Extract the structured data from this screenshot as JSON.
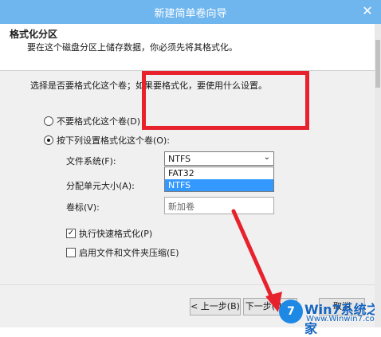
{
  "window": {
    "title": "新建简单卷向导",
    "close_glyph": "✕"
  },
  "header": {
    "title": "格式化分区",
    "subtitle": "要在这个磁盘分区上储存数据，你必须先将其格式化。"
  },
  "prompt": "选择是否要格式化这个卷；如果要格式化，要使用什么设置。",
  "options": {
    "no_format": "不要格式化这个卷(D)",
    "format": "按下列设置格式化这个卷(O):"
  },
  "fields": {
    "filesystem_label": "文件系统(F):",
    "filesystem_value": "NTFS",
    "filesystem_options": [
      "FAT32",
      "NTFS"
    ],
    "allocation_label": "分配单元大小(A):",
    "volume_label_label": "卷标(V):",
    "volume_label_value": "新加卷"
  },
  "checkboxes": {
    "quick_format": "执行快速格式化(P)",
    "compression": "启用文件和文件夹压缩(E)"
  },
  "buttons": {
    "back": "< 上一步(B)",
    "next": "下一步(N) >",
    "cancel": "取消"
  },
  "watermark": {
    "logo": "7",
    "main": "Win7系统之家",
    "sub": "Www.Winwin7.com"
  },
  "colors": {
    "titlebar": "#6fb6ee",
    "highlight": "#3399ff",
    "annotation": "#e8222c"
  }
}
